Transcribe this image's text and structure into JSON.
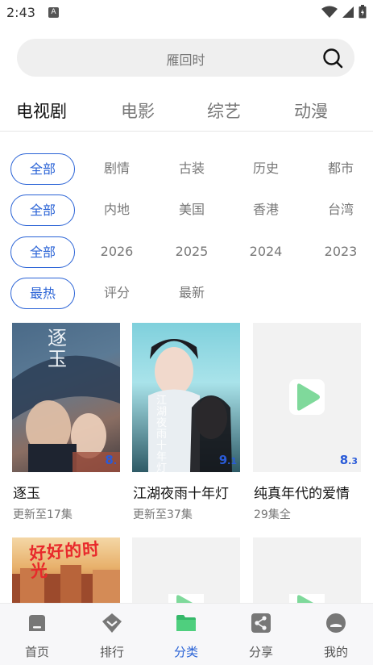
{
  "status": {
    "time": "2:43",
    "notif": "A"
  },
  "search": {
    "placeholder": "雁回时"
  },
  "tabs": [
    {
      "label": "电视剧",
      "active": true
    },
    {
      "label": "电影",
      "active": false
    },
    {
      "label": "综艺",
      "active": false
    },
    {
      "label": "动漫",
      "active": false
    }
  ],
  "filters": {
    "genre": [
      "全部",
      "剧情",
      "古装",
      "历史",
      "都市"
    ],
    "region": [
      "全部",
      "内地",
      "美国",
      "香港",
      "台湾"
    ],
    "year": [
      "全部",
      "2026",
      "2025",
      "2024",
      "2023"
    ],
    "sort": [
      "最热",
      "评分",
      "最新"
    ]
  },
  "cards": [
    {
      "title": "逐玉",
      "sub": "更新至17集",
      "rating_main": "8",
      "rating_dec": ".",
      "poster": "poster-zhuyu",
      "poster_text": "逐玉"
    },
    {
      "title": "江湖夜雨十年灯",
      "sub": "更新至37集",
      "rating_main": "9",
      "rating_dec": ".1",
      "poster": "poster-jianghu",
      "poster_text": "江湖夜雨十年灯"
    },
    {
      "title": "纯真年代的爱情",
      "sub": "29集全",
      "rating_main": "8",
      "rating_dec": ".3",
      "poster": "placeholder"
    },
    {
      "title": "",
      "sub": "",
      "poster": "poster-haohao",
      "poster_text": "好好的时光"
    },
    {
      "title": "",
      "sub": "",
      "poster": "placeholder"
    },
    {
      "title": "",
      "sub": "",
      "poster": "placeholder"
    }
  ],
  "nav": [
    {
      "label": "首页",
      "icon": "home-icon",
      "active": false
    },
    {
      "label": "排行",
      "icon": "ranking-icon",
      "active": false
    },
    {
      "label": "分类",
      "icon": "folder-icon",
      "active": true
    },
    {
      "label": "分享",
      "icon": "share-icon",
      "active": false
    },
    {
      "label": "我的",
      "icon": "profile-icon",
      "active": false
    }
  ],
  "colors": {
    "accent": "#2a63d6",
    "placeholder_logo": "#7fd99b"
  }
}
